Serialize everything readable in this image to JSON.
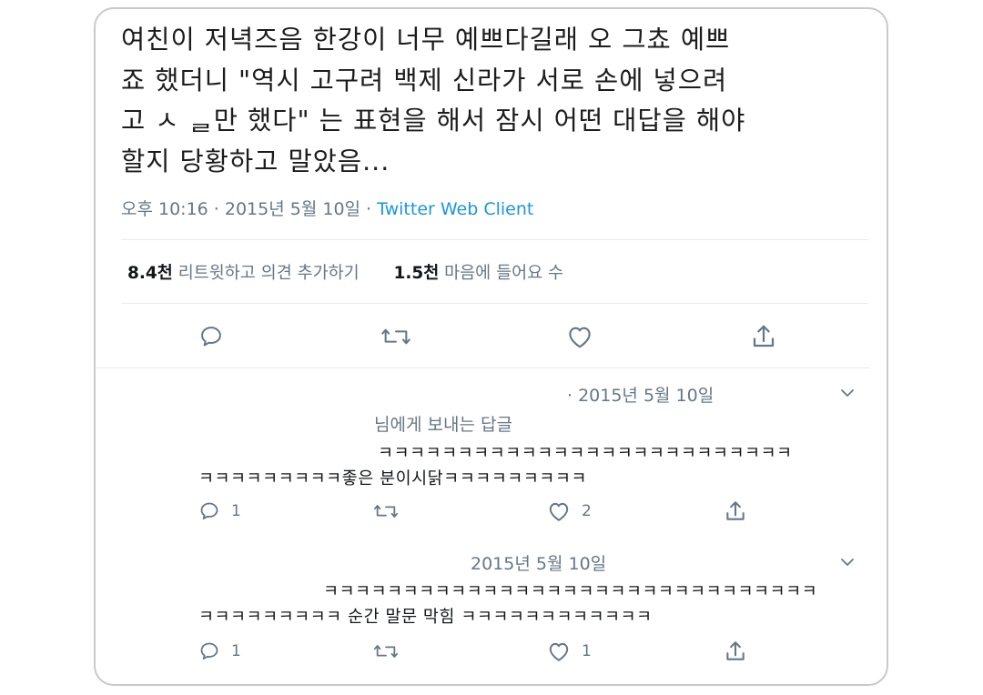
{
  "tweet": {
    "lines": [
      "여친이 저녁즈음 한강이 너무 예쁘다길래 오 그쵸 예쁘",
      "죠 했더니 \"역시 고구려 백제 신라가 서로 손에 넣으려",
      "고 ㅅ  ᆯ만 했다\" 는 표현을 해서 잠시 어떤 대답을 해야",
      "할지 당황하고 말았음..."
    ],
    "time": "오후 10:16 · 2015년 5월 10일 · ",
    "client": "Twitter Web Client",
    "retweets_count": "8.4천",
    "retweets_label": "리트윗하고 의견 추가하기",
    "likes_count": "1.5천",
    "likes_label": "마음에 들어요 수"
  },
  "replies": [
    {
      "date": "· 2015년 5월 10일",
      "reply_to": "님에게 보내는 답글",
      "line1": "ㅋㅋㅋㅋㅋㅋㅋㅋㅋㅋㅋㅋㅋㅋㅋㅋㅋㅋㅋㅋㅋㅋㅋㅋㅋㅋ",
      "line2": "ㅋㅋㅋㅋㅋㅋㅋㅋㅋ좋은 분이시닭ㅋㅋㅋㅋㅋㅋㅋㅋㅋ",
      "reply_count": "1",
      "like_count": "2"
    },
    {
      "date": "2015년 5월 10일",
      "line1": "ㅋㅋㅋㅋㅋㅋㅋㅋㅋㅋㅋㅋㅋㅋㅋㅋㅋㅋㅋㅋㅋㅋㅋㅋㅋㅋㅋㅋㅋㅋㅋ",
      "line2": "ㅋㅋㅋㅋㅋㅋㅋㅋㅋ 순간 말문 막힘 ㅋㅋㅋㅋㅋㅋㅋㅋㅋㅋㅋㅋ",
      "reply_count": "1",
      "like_count": "1"
    }
  ],
  "colors": {
    "text": "#14171a",
    "secondary": "#657786",
    "link": "#1b95e0",
    "divider": "#e6ecf0"
  }
}
